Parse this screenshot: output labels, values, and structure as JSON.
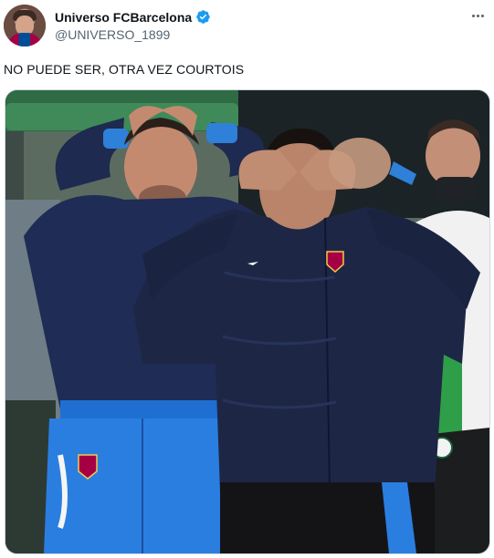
{
  "author": {
    "display_name": "Universo FCBarcelona",
    "handle": "@UNIVERSO_1899",
    "verified_icon": "verified-badge-icon",
    "brand_color": "#1d9bf0"
  },
  "tweet": {
    "text": "NO PUEDE SER, OTRA VEZ COURTOIS"
  },
  "media": {
    "icon": "photo-icon"
  },
  "menu": {
    "icon": "more-options-icon"
  }
}
